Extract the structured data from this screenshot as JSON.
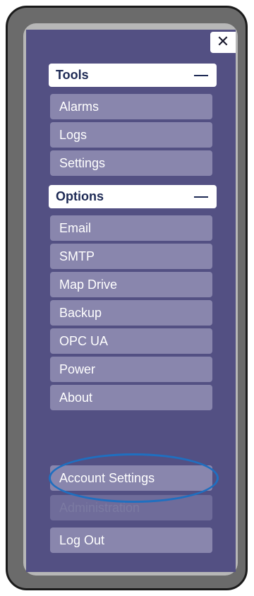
{
  "close": {
    "symbol": "✕"
  },
  "sections": {
    "tools": {
      "title": "Tools",
      "items": [
        "Alarms",
        "Logs",
        "Settings"
      ]
    },
    "options": {
      "title": "Options",
      "items": [
        "Email",
        "SMTP",
        "Map Drive",
        "Backup",
        "OPC UA",
        "Power",
        "About"
      ]
    }
  },
  "account": {
    "account_settings": "Account Settings",
    "administration": "Administration",
    "log_out": "Log Out"
  },
  "colors": {
    "panel": "#535083",
    "item": "#8986ad",
    "highlight": "#1f6fc0"
  },
  "icons": {
    "close": "close-icon",
    "collapse": "minus-icon"
  }
}
